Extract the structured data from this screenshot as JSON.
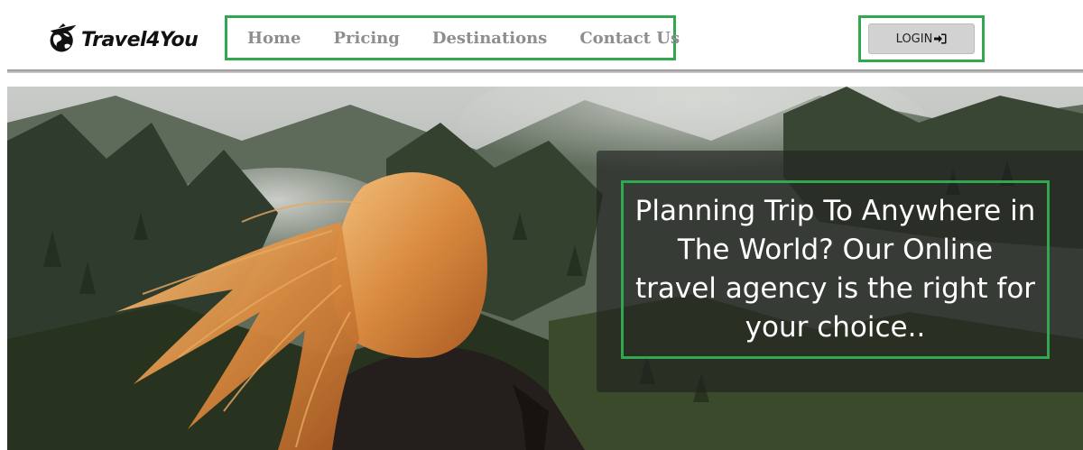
{
  "brand": {
    "name": "Travel4You",
    "logo_icon": "globe-plane-logo-icon"
  },
  "nav": {
    "items": [
      {
        "label": "Home"
      },
      {
        "label": "Pricing"
      },
      {
        "label": "Destinations"
      },
      {
        "label": "Contact Us"
      }
    ]
  },
  "login": {
    "label": "LOGIN",
    "icon": "sign-in-icon"
  },
  "hero": {
    "tagline": "Planning Trip To Anywhere in The World? Our Online travel agency is the right for your choice..",
    "image": "woman-with-red-hair-facing-forested-mountains"
  },
  "colors": {
    "highlight_border": "#2fa84f",
    "nav_text": "#8e8e8e",
    "login_bg": "#d2d2d2",
    "overlay": "rgba(30,32,30,0.62)"
  }
}
